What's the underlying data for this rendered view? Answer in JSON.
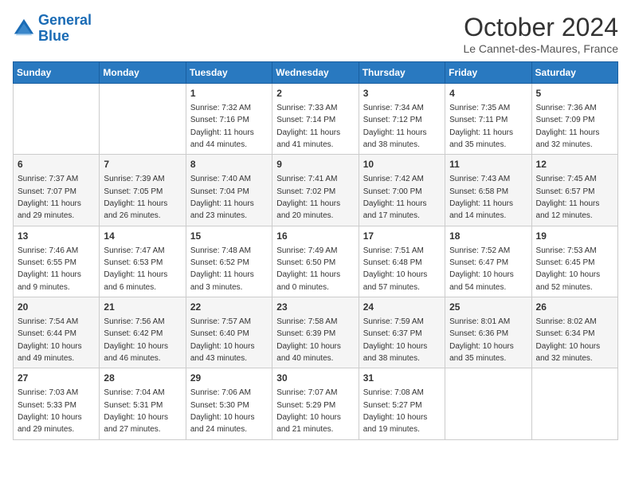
{
  "logo": {
    "line1": "General",
    "line2": "Blue"
  },
  "title": "October 2024",
  "location": "Le Cannet-des-Maures, France",
  "weekdays": [
    "Sunday",
    "Monday",
    "Tuesday",
    "Wednesday",
    "Thursday",
    "Friday",
    "Saturday"
  ],
  "weeks": [
    [
      {
        "day": "",
        "sunrise": "",
        "sunset": "",
        "daylight": ""
      },
      {
        "day": "",
        "sunrise": "",
        "sunset": "",
        "daylight": ""
      },
      {
        "day": "1",
        "sunrise": "Sunrise: 7:32 AM",
        "sunset": "Sunset: 7:16 PM",
        "daylight": "Daylight: 11 hours and 44 minutes."
      },
      {
        "day": "2",
        "sunrise": "Sunrise: 7:33 AM",
        "sunset": "Sunset: 7:14 PM",
        "daylight": "Daylight: 11 hours and 41 minutes."
      },
      {
        "day": "3",
        "sunrise": "Sunrise: 7:34 AM",
        "sunset": "Sunset: 7:12 PM",
        "daylight": "Daylight: 11 hours and 38 minutes."
      },
      {
        "day": "4",
        "sunrise": "Sunrise: 7:35 AM",
        "sunset": "Sunset: 7:11 PM",
        "daylight": "Daylight: 11 hours and 35 minutes."
      },
      {
        "day": "5",
        "sunrise": "Sunrise: 7:36 AM",
        "sunset": "Sunset: 7:09 PM",
        "daylight": "Daylight: 11 hours and 32 minutes."
      }
    ],
    [
      {
        "day": "6",
        "sunrise": "Sunrise: 7:37 AM",
        "sunset": "Sunset: 7:07 PM",
        "daylight": "Daylight: 11 hours and 29 minutes."
      },
      {
        "day": "7",
        "sunrise": "Sunrise: 7:39 AM",
        "sunset": "Sunset: 7:05 PM",
        "daylight": "Daylight: 11 hours and 26 minutes."
      },
      {
        "day": "8",
        "sunrise": "Sunrise: 7:40 AM",
        "sunset": "Sunset: 7:04 PM",
        "daylight": "Daylight: 11 hours and 23 minutes."
      },
      {
        "day": "9",
        "sunrise": "Sunrise: 7:41 AM",
        "sunset": "Sunset: 7:02 PM",
        "daylight": "Daylight: 11 hours and 20 minutes."
      },
      {
        "day": "10",
        "sunrise": "Sunrise: 7:42 AM",
        "sunset": "Sunset: 7:00 PM",
        "daylight": "Daylight: 11 hours and 17 minutes."
      },
      {
        "day": "11",
        "sunrise": "Sunrise: 7:43 AM",
        "sunset": "Sunset: 6:58 PM",
        "daylight": "Daylight: 11 hours and 14 minutes."
      },
      {
        "day": "12",
        "sunrise": "Sunrise: 7:45 AM",
        "sunset": "Sunset: 6:57 PM",
        "daylight": "Daylight: 11 hours and 12 minutes."
      }
    ],
    [
      {
        "day": "13",
        "sunrise": "Sunrise: 7:46 AM",
        "sunset": "Sunset: 6:55 PM",
        "daylight": "Daylight: 11 hours and 9 minutes."
      },
      {
        "day": "14",
        "sunrise": "Sunrise: 7:47 AM",
        "sunset": "Sunset: 6:53 PM",
        "daylight": "Daylight: 11 hours and 6 minutes."
      },
      {
        "day": "15",
        "sunrise": "Sunrise: 7:48 AM",
        "sunset": "Sunset: 6:52 PM",
        "daylight": "Daylight: 11 hours and 3 minutes."
      },
      {
        "day": "16",
        "sunrise": "Sunrise: 7:49 AM",
        "sunset": "Sunset: 6:50 PM",
        "daylight": "Daylight: 11 hours and 0 minutes."
      },
      {
        "day": "17",
        "sunrise": "Sunrise: 7:51 AM",
        "sunset": "Sunset: 6:48 PM",
        "daylight": "Daylight: 10 hours and 57 minutes."
      },
      {
        "day": "18",
        "sunrise": "Sunrise: 7:52 AM",
        "sunset": "Sunset: 6:47 PM",
        "daylight": "Daylight: 10 hours and 54 minutes."
      },
      {
        "day": "19",
        "sunrise": "Sunrise: 7:53 AM",
        "sunset": "Sunset: 6:45 PM",
        "daylight": "Daylight: 10 hours and 52 minutes."
      }
    ],
    [
      {
        "day": "20",
        "sunrise": "Sunrise: 7:54 AM",
        "sunset": "Sunset: 6:44 PM",
        "daylight": "Daylight: 10 hours and 49 minutes."
      },
      {
        "day": "21",
        "sunrise": "Sunrise: 7:56 AM",
        "sunset": "Sunset: 6:42 PM",
        "daylight": "Daylight: 10 hours and 46 minutes."
      },
      {
        "day": "22",
        "sunrise": "Sunrise: 7:57 AM",
        "sunset": "Sunset: 6:40 PM",
        "daylight": "Daylight: 10 hours and 43 minutes."
      },
      {
        "day": "23",
        "sunrise": "Sunrise: 7:58 AM",
        "sunset": "Sunset: 6:39 PM",
        "daylight": "Daylight: 10 hours and 40 minutes."
      },
      {
        "day": "24",
        "sunrise": "Sunrise: 7:59 AM",
        "sunset": "Sunset: 6:37 PM",
        "daylight": "Daylight: 10 hours and 38 minutes."
      },
      {
        "day": "25",
        "sunrise": "Sunrise: 8:01 AM",
        "sunset": "Sunset: 6:36 PM",
        "daylight": "Daylight: 10 hours and 35 minutes."
      },
      {
        "day": "26",
        "sunrise": "Sunrise: 8:02 AM",
        "sunset": "Sunset: 6:34 PM",
        "daylight": "Daylight: 10 hours and 32 minutes."
      }
    ],
    [
      {
        "day": "27",
        "sunrise": "Sunrise: 7:03 AM",
        "sunset": "Sunset: 5:33 PM",
        "daylight": "Daylight: 10 hours and 29 minutes."
      },
      {
        "day": "28",
        "sunrise": "Sunrise: 7:04 AM",
        "sunset": "Sunset: 5:31 PM",
        "daylight": "Daylight: 10 hours and 27 minutes."
      },
      {
        "day": "29",
        "sunrise": "Sunrise: 7:06 AM",
        "sunset": "Sunset: 5:30 PM",
        "daylight": "Daylight: 10 hours and 24 minutes."
      },
      {
        "day": "30",
        "sunrise": "Sunrise: 7:07 AM",
        "sunset": "Sunset: 5:29 PM",
        "daylight": "Daylight: 10 hours and 21 minutes."
      },
      {
        "day": "31",
        "sunrise": "Sunrise: 7:08 AM",
        "sunset": "Sunset: 5:27 PM",
        "daylight": "Daylight: 10 hours and 19 minutes."
      },
      {
        "day": "",
        "sunrise": "",
        "sunset": "",
        "daylight": ""
      },
      {
        "day": "",
        "sunrise": "",
        "sunset": "",
        "daylight": ""
      }
    ]
  ]
}
